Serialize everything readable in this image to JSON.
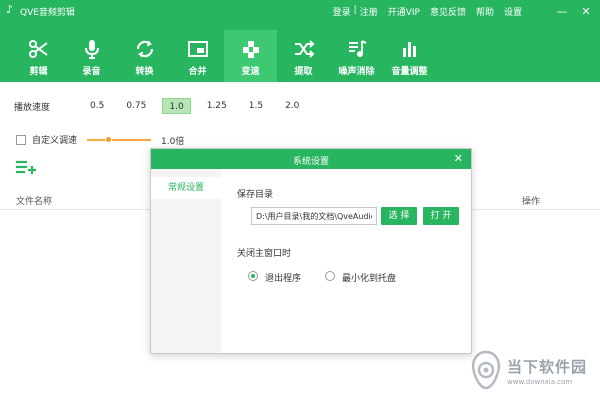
{
  "app": {
    "title": "QVE音频剪辑"
  },
  "top_links": [
    "登录",
    "|",
    "注册",
    "开通VIP",
    "意见反馈",
    "帮助",
    "设置"
  ],
  "toolbar": [
    {
      "label": "剪辑",
      "icon": "scissors-icon"
    },
    {
      "label": "录音",
      "icon": "microphone-icon"
    },
    {
      "label": "转换",
      "icon": "convert-arrows-icon"
    },
    {
      "label": "合并",
      "icon": "merge-icon"
    },
    {
      "label": "变速",
      "icon": "speed-change-icon",
      "active": true
    },
    {
      "label": "提取",
      "icon": "shuffle-icon"
    },
    {
      "label": "噪声消除",
      "icon": "music-note-icon"
    },
    {
      "label": "音量调整",
      "icon": "volume-bars-icon"
    }
  ],
  "speed": {
    "label": "播放速度",
    "options": [
      "0.5",
      "0.75",
      "1.0",
      "1.25",
      "1.5",
      "2.0"
    ],
    "selected": "1.0"
  },
  "custom_speed": {
    "label": "自定义调速",
    "value": "1.0倍",
    "checked": false,
    "level": 0.3
  },
  "list": {
    "col_name": "文件名称",
    "col_op": "操作"
  },
  "dialog": {
    "title": "系统设置",
    "tab": "常规设置",
    "save_dir_label": "保存目录",
    "save_path": "D:\\用户目录\\我的文档\\QveAudio",
    "choose_btn": "选 择",
    "open_btn": "打 开",
    "close_label": "关闭主窗口时",
    "opt_exit": "退出程序",
    "opt_tray": "最小化到托盘",
    "selected": "退出程序"
  },
  "watermark": {
    "title": "当下软件园",
    "url": "www.downxia.com"
  },
  "colors": {
    "brand": "#27b560",
    "brand_active": "#3ec872",
    "slider": "#f39c1f"
  }
}
